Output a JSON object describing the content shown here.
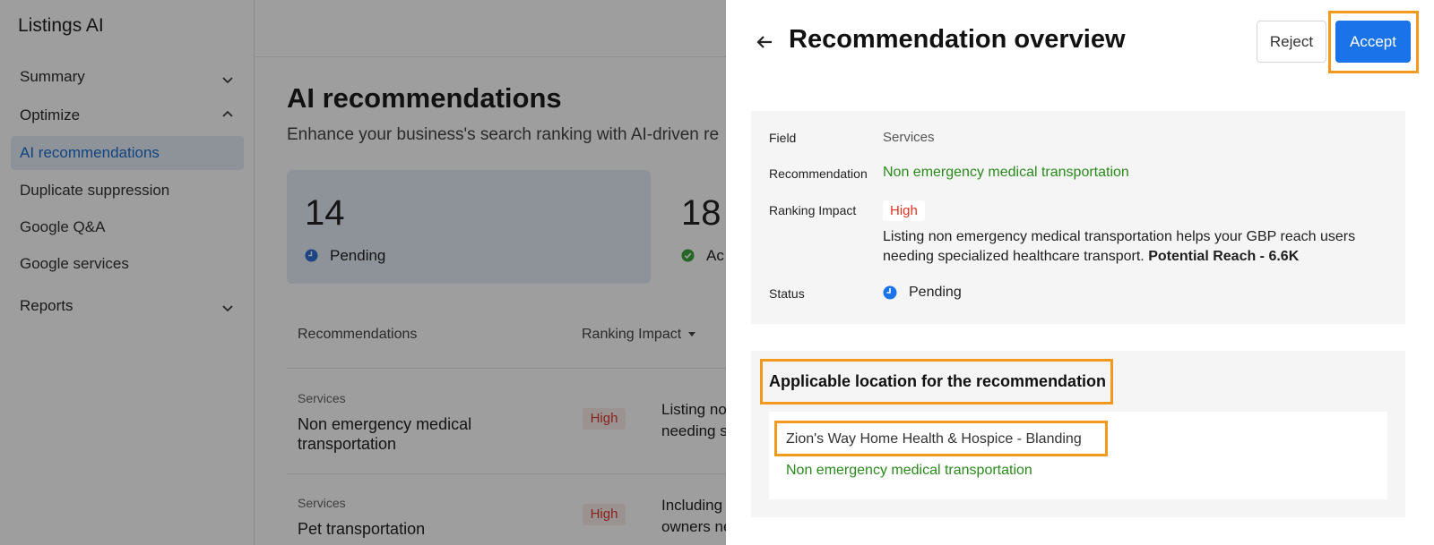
{
  "sidebar": {
    "brand": "Listings AI",
    "groups": {
      "summary": "Summary",
      "optimize": "Optimize",
      "reports": "Reports"
    },
    "items": [
      "AI recommendations",
      "Duplicate suppression",
      "Google Q&A",
      "Google services"
    ]
  },
  "main": {
    "title": "AI recommendations",
    "subtitle": "Enhance your business's search ranking with AI-driven re",
    "stats": [
      {
        "count": "14",
        "label": "Pending"
      },
      {
        "count": "18",
        "label": "Ac"
      }
    ],
    "table": {
      "col_recommendations": "Recommendations",
      "col_ranking": "Ranking Impact",
      "rows": [
        {
          "category": "Services",
          "name": "Non emergency medical transportation",
          "impact": "High",
          "desc1": "Listing no",
          "desc2": "needing s"
        },
        {
          "category": "Services",
          "name": "Pet transportation",
          "impact": "High",
          "desc1": "Including",
          "desc2": "owners ne"
        }
      ]
    }
  },
  "drawer": {
    "title": "Recommendation overview",
    "reject_label": "Reject",
    "accept_label": "Accept",
    "details": {
      "field_label": "Field",
      "field_value": "Services",
      "recommendation_label": "Recommendation",
      "recommendation_value": "Non emergency medical transportation",
      "ranking_label": "Ranking Impact",
      "ranking_value": "High",
      "description": "Listing non emergency medical transportation helps your GBP reach users needing specialized healthcare transport.",
      "potential_reach": "Potential Reach - 6.6K",
      "status_label": "Status",
      "status_value": "Pending"
    },
    "locations": {
      "title": "Applicable location for the recommendation",
      "items": [
        {
          "name": "Zion's Way Home Health & Hospice - Blanding",
          "recommendation": "Non emergency medical transportation"
        }
      ]
    }
  },
  "colors": {
    "accent": "#1a73e8",
    "highlight": "#f39a1e",
    "success": "#2a8a1c",
    "danger": "#e0321f",
    "pending": "#2f6fd6"
  }
}
